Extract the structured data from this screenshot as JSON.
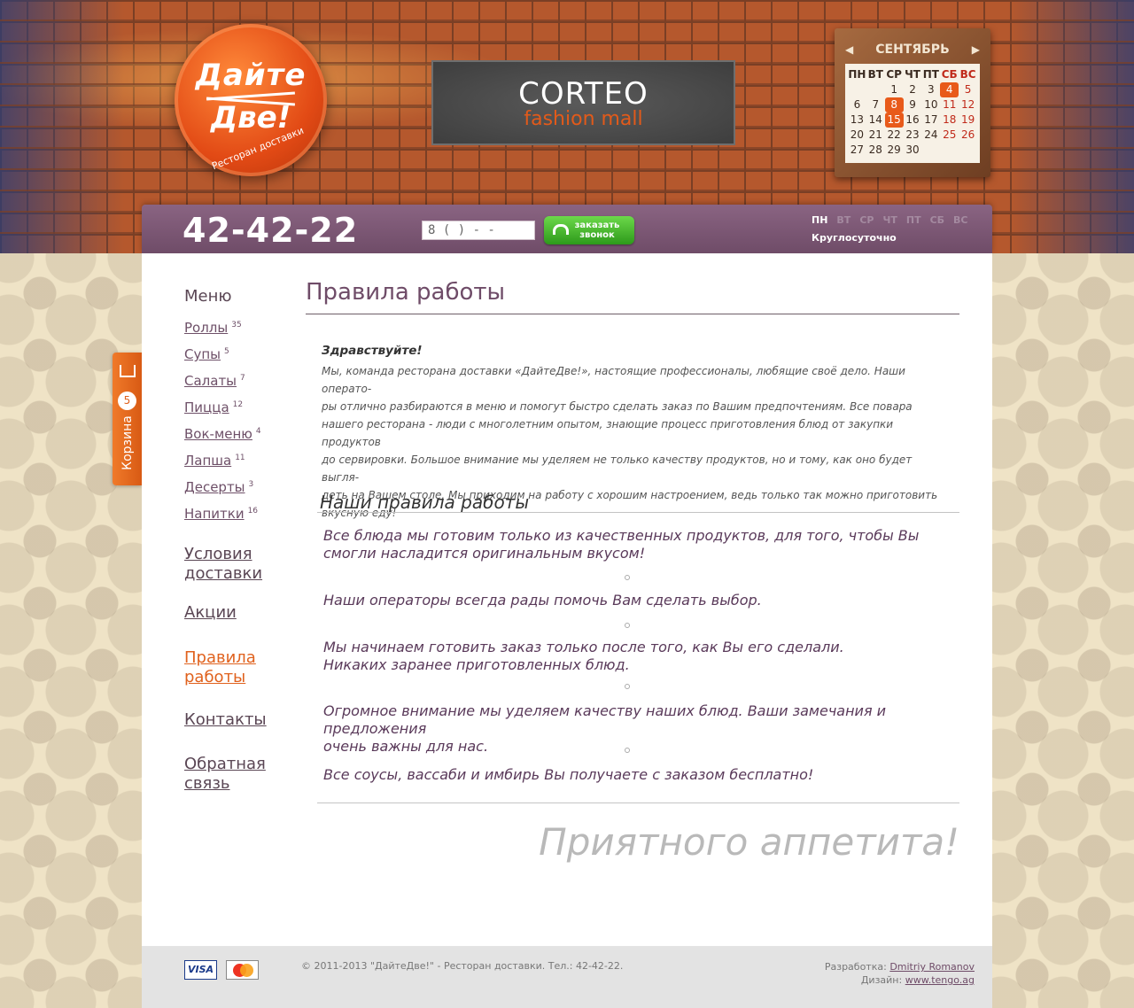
{
  "logo": {
    "line1": "Дайте",
    "line2": "Две!",
    "subtitle": "Ресторан доставки"
  },
  "banner": {
    "brand": "CORTEO",
    "sub": "fashion mall"
  },
  "calendar": {
    "month": "СЕНТЯБРЬ",
    "weekdays": [
      "ПН",
      "ВТ",
      "СР",
      "ЧТ",
      "ПТ",
      "СБ",
      "ВС"
    ],
    "weeks": [
      [
        "",
        "",
        "1",
        "2",
        "3",
        "4",
        "5"
      ],
      [
        "6",
        "7",
        "8",
        "9",
        "10",
        "11",
        "12"
      ],
      [
        "13",
        "14",
        "15",
        "16",
        "17",
        "18",
        "19"
      ],
      [
        "20",
        "21",
        "22",
        "23",
        "24",
        "25",
        "26"
      ],
      [
        "27",
        "28",
        "29",
        "30",
        "",
        "",
        ""
      ]
    ],
    "highlighted": [
      "4",
      "8",
      "15"
    ]
  },
  "header": {
    "phone": "42-42-22",
    "phone_input_value": "8 (    )     -   -",
    "callback_line1": "заказать",
    "callback_line2": "звонок",
    "days": [
      "ПН",
      "ВТ",
      "СР",
      "ЧТ",
      "ПТ",
      "СБ",
      "ВС"
    ],
    "hours": "Круглосуточно"
  },
  "cart": {
    "label": "Корзина",
    "count": "5"
  },
  "sidebar": {
    "menu_title": "Меню",
    "items": [
      {
        "label": "Роллы",
        "count": "35"
      },
      {
        "label": "Супы",
        "count": "5"
      },
      {
        "label": "Салаты",
        "count": "7"
      },
      {
        "label": "Пицца",
        "count": "12"
      },
      {
        "label": "Вок-меню",
        "count": "4"
      },
      {
        "label": "Лапша",
        "count": "11"
      },
      {
        "label": "Десерты",
        "count": "3"
      },
      {
        "label": "Напитки",
        "count": "16"
      }
    ],
    "links": {
      "delivery_1": "Условия",
      "delivery_2": "доставки",
      "promo": "Акции",
      "rules_1": "Правила",
      "rules_2": "работы",
      "contacts": "Контакты",
      "feedback_1": "Обратная",
      "feedback_2": "связь"
    }
  },
  "content": {
    "title": "Правила работы",
    "greeting": "Здравствуйте!",
    "intro_lines": [
      "Мы, команда ресторана доставки «ДайтеДве!», настоящие профессионалы, любящие своё дело. Наши операто-",
      "ры отлично разбираются в меню и помогут быстро сделать заказ по Вашим предпочтениям. Все повара",
      "нашего ресторана - люди с многолетним опытом, знающие процесс приготовления блюд от закупки продуктов",
      "до сервировки. Большое внимание мы уделяем не только качеству продуктов, но и тому, как оно будет выгля-",
      "деть на Вашем столе. Мы приходим на работу с хорошим настроением, ведь только так можно приготовить",
      "вкусную еду!"
    ],
    "rules_title": "Наши правила работы",
    "rules": [
      [
        "Все блюда мы готовим только из качественных продуктов, для того, чтобы Вы",
        "смогли насладится оригинальным вкусом!"
      ],
      [
        "Наши операторы всегда рады помочь Вам сделать выбор."
      ],
      [
        "Мы начинаем готовить заказ только после того, как Вы его сделали.",
        "Никаких заранее приготовленных блюд."
      ],
      [
        "Огромное внимание мы уделяем качеству наших блюд. Ваши замечания и предложения",
        "очень важны для нас."
      ],
      [
        "Все соусы, вассаби и имбирь Вы получаете с заказом бесплатно!"
      ]
    ],
    "closing": "Приятного аппетита!"
  },
  "footer": {
    "visa": "VISA",
    "copyright": "© 2011-2013 \"ДайтеДве!\" - Ресторан доставки.   Тел.: 42-42-22.",
    "dev_label": "Разработка:",
    "dev_name": "Dmitriy Romanov",
    "design_label": "Дизайн:",
    "design_name": "www.tengo.ag"
  },
  "colors": {
    "accent": "#e0621e",
    "purple": "#6f4c68",
    "green": "#2d9a1b"
  }
}
